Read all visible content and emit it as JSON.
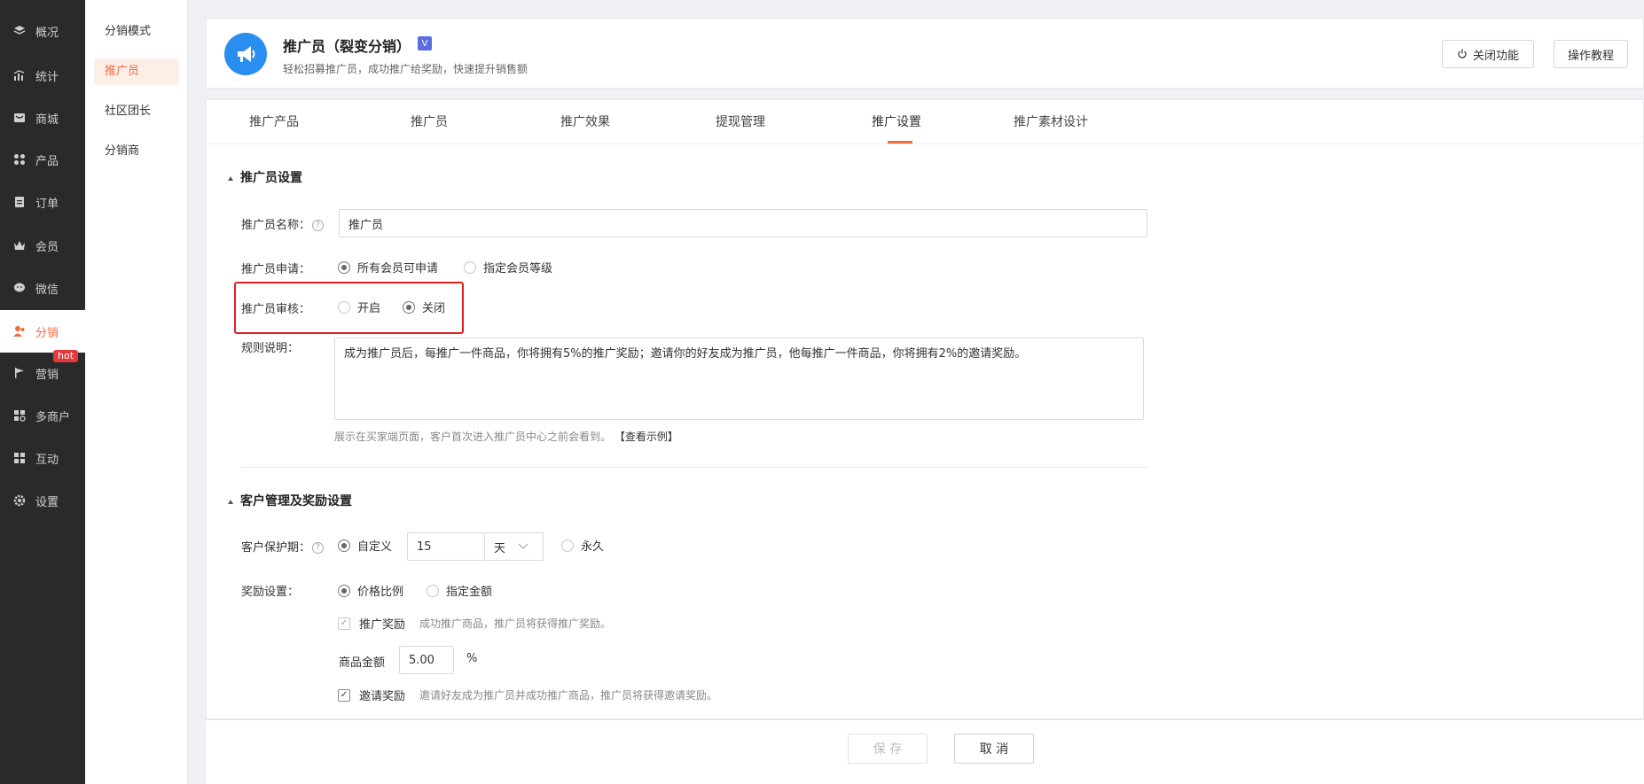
{
  "nav": [
    {
      "label": "概况",
      "icon": "layers-icon"
    },
    {
      "label": "统计",
      "icon": "chart-icon"
    },
    {
      "label": "商城",
      "icon": "store-icon"
    },
    {
      "label": "产品",
      "icon": "grid-icon"
    },
    {
      "label": "订单",
      "icon": "order-icon"
    },
    {
      "label": "会员",
      "icon": "crown-icon"
    },
    {
      "label": "微信",
      "icon": "wechat-icon"
    },
    {
      "label": "分销",
      "icon": "users-icon"
    },
    {
      "label": "营销",
      "icon": "flag-icon"
    },
    {
      "label": "多商户",
      "icon": "shop-icon"
    },
    {
      "label": "互动",
      "icon": "apps-icon"
    },
    {
      "label": "设置",
      "icon": "gear-icon"
    }
  ],
  "hot_badge": "hot",
  "subnav": [
    "分销模式",
    "推广员",
    "社区团长",
    "分销商"
  ],
  "header": {
    "title": "推广员（裂变分销）",
    "subtitle": "轻松招募推广员，成功推广给奖励，快速提升销售额",
    "close_btn": "关闭功能",
    "tutorial_btn": "操作教程"
  },
  "tabs": [
    "推广产品",
    "推广员",
    "推广效果",
    "提现管理",
    "推广设置",
    "推广素材设计"
  ],
  "section1": {
    "title": "推广员设置",
    "name_label": "推广员名称：",
    "name_value": "推广员",
    "apply_label": "推广员申请：",
    "apply_opt1": "所有会员可申请",
    "apply_opt2": "指定会员等级",
    "audit_label": "推广员审核：",
    "audit_opt1": "开启",
    "audit_opt2": "关闭",
    "rule_label": "规则说明：",
    "rule_text": "成为推广员后，每推广一件商品，你将拥有5%的推广奖励；邀请你的好友成为推广员，他每推广一件商品，你将拥有2%的邀请奖励。",
    "rule_hint": "展示在买家端页面，客户首次进入推广员中心之前会看到。",
    "rule_link": "【查看示例】"
  },
  "section2": {
    "title": "客户管理及奖励设置",
    "protect_label": "客户保护期：",
    "protect_custom": "自定义",
    "protect_value": "15",
    "protect_unit": "天",
    "protect_forever": "永久",
    "reward_label": "奖励设置：",
    "reward_opt1": "价格比例",
    "reward_opt2": "指定金额",
    "promo_reward": "推广奖励",
    "promo_reward_desc": "成功推广商品，推广员将获得推广奖励。",
    "amount_label": "商品金额",
    "amount_value": "5.00",
    "amount_unit": "%",
    "invite_reward": "邀请奖励",
    "invite_reward_desc": "邀请好友成为推广员并成功推广商品，推广员将获得邀请奖励。"
  },
  "footer": {
    "save": "保 存",
    "cancel": "取 消"
  }
}
